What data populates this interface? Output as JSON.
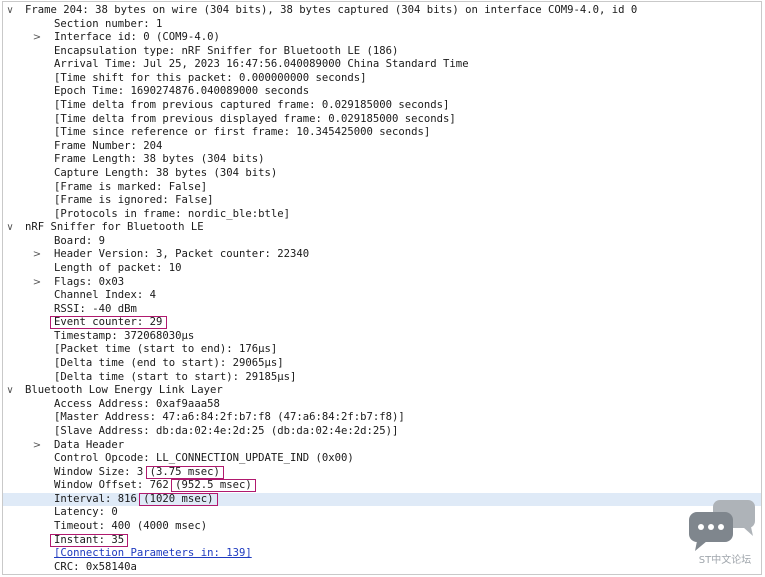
{
  "packet_details": {
    "rows": [
      {
        "level": 0,
        "toggle": "expanded",
        "text": "Frame 204: 38 bytes on wire (304 bits), 38 bytes captured (304 bits) on interface COM9-4.0, id 0"
      },
      {
        "level": 1,
        "toggle": "none",
        "text": "Section number: 1"
      },
      {
        "level": 1,
        "toggle": "collapsed",
        "text": "Interface id: 0 (COM9-4.0)"
      },
      {
        "level": 1,
        "toggle": "none",
        "text": "Encapsulation type: nRF Sniffer for Bluetooth LE (186)"
      },
      {
        "level": 1,
        "toggle": "none",
        "text": "Arrival Time: Jul 25, 2023 16:47:56.040089000 China Standard Time"
      },
      {
        "level": 1,
        "toggle": "none",
        "text": "[Time shift for this packet: 0.000000000 seconds]"
      },
      {
        "level": 1,
        "toggle": "none",
        "text": "Epoch Time: 1690274876.040089000 seconds"
      },
      {
        "level": 1,
        "toggle": "none",
        "text": "[Time delta from previous captured frame: 0.029185000 seconds]"
      },
      {
        "level": 1,
        "toggle": "none",
        "text": "[Time delta from previous displayed frame: 0.029185000 seconds]"
      },
      {
        "level": 1,
        "toggle": "none",
        "text": "[Time since reference or first frame: 10.345425000 seconds]"
      },
      {
        "level": 1,
        "toggle": "none",
        "text": "Frame Number: 204"
      },
      {
        "level": 1,
        "toggle": "none",
        "text": "Frame Length: 38 bytes (304 bits)"
      },
      {
        "level": 1,
        "toggle": "none",
        "text": "Capture Length: 38 bytes (304 bits)"
      },
      {
        "level": 1,
        "toggle": "none",
        "text": "[Frame is marked: False]"
      },
      {
        "level": 1,
        "toggle": "none",
        "text": "[Frame is ignored: False]"
      },
      {
        "level": 1,
        "toggle": "none",
        "text": "[Protocols in frame: nordic_ble:btle]"
      },
      {
        "level": 0,
        "toggle": "expanded",
        "text": "nRF Sniffer for Bluetooth LE"
      },
      {
        "level": 1,
        "toggle": "none",
        "text": "Board: 9"
      },
      {
        "level": 1,
        "toggle": "collapsed",
        "text": "Header Version: 3, Packet counter: 22340"
      },
      {
        "level": 1,
        "toggle": "none",
        "text": "Length of packet: 10"
      },
      {
        "level": 1,
        "toggle": "collapsed",
        "text": "Flags: 0x03"
      },
      {
        "level": 1,
        "toggle": "none",
        "text": "Channel Index: 4"
      },
      {
        "level": 1,
        "toggle": "none",
        "text": "RSSI: -40 dBm"
      },
      {
        "level": 1,
        "toggle": "none",
        "text": "Event counter: 29",
        "highlight": "whole"
      },
      {
        "level": 1,
        "toggle": "none",
        "text": "Timestamp: 372068030µs"
      },
      {
        "level": 1,
        "toggle": "none",
        "text": "[Packet time (start to end): 176µs]"
      },
      {
        "level": 1,
        "toggle": "none",
        "text": "[Delta time (end to start): 29065µs]"
      },
      {
        "level": 1,
        "toggle": "none",
        "text": "[Delta time (start to start): 29185µs]"
      },
      {
        "level": 0,
        "toggle": "expanded",
        "text": "Bluetooth Low Energy Link Layer"
      },
      {
        "level": 1,
        "toggle": "none",
        "text": "Access Address: 0xaf9aaa58"
      },
      {
        "level": 1,
        "toggle": "none",
        "text": "[Master Address: 47:a6:84:2f:b7:f8 (47:a6:84:2f:b7:f8)]"
      },
      {
        "level": 1,
        "toggle": "none",
        "text": "[Slave Address: db:da:02:4e:2d:25 (db:da:02:4e:2d:25)]"
      },
      {
        "level": 1,
        "toggle": "collapsed",
        "text": "Data Header"
      },
      {
        "level": 1,
        "toggle": "none",
        "text": "Control Opcode: LL_CONNECTION_UPDATE_IND (0x00)"
      },
      {
        "level": 1,
        "toggle": "none",
        "text": "Window Size: 3 (3.75 msec)",
        "highlight": "(3.75 msec)"
      },
      {
        "level": 1,
        "toggle": "none",
        "text": "Window Offset: 762 (952.5 msec)",
        "highlight": "(952.5 msec)"
      },
      {
        "level": 1,
        "toggle": "none",
        "text": "Interval: 816 (1020 msec)",
        "highlight": "(1020 msec)",
        "selected": true
      },
      {
        "level": 1,
        "toggle": "none",
        "text": "Latency: 0"
      },
      {
        "level": 1,
        "toggle": "none",
        "text": "Timeout: 400 (4000 msec)"
      },
      {
        "level": 1,
        "toggle": "none",
        "text": "Instant: 35",
        "highlight": "whole"
      },
      {
        "level": 1,
        "toggle": "none",
        "text": "[Connection Parameters in: 139]",
        "link": true
      },
      {
        "level": 1,
        "toggle": "none",
        "text": "CRC: 0x58140a"
      }
    ]
  },
  "watermark": {
    "label": "ST中文论坛",
    "icon": "chat-bubbles-icon"
  },
  "colors": {
    "highlight_box": "#b0196e",
    "selected_row": "#dfeaf7",
    "link": "#1f3bbf"
  }
}
